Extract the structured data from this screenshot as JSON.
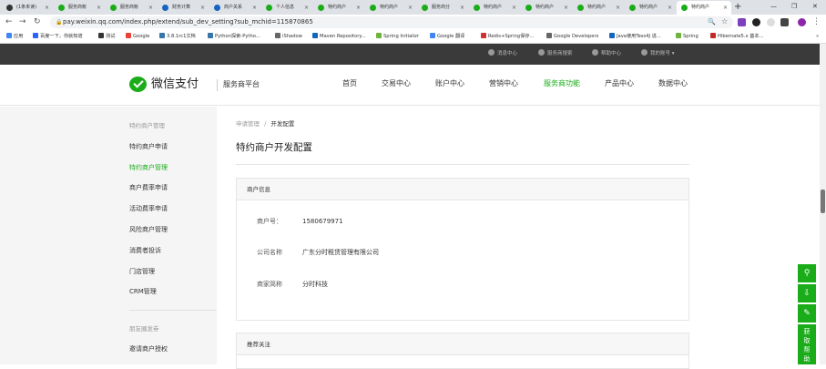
{
  "browser": {
    "tabs": [
      {
        "label": "(1条未读)",
        "color": "#333333"
      },
      {
        "label": "服务商帐",
        "color": "#1aad19"
      },
      {
        "label": "服务商帐",
        "color": "#1aad19"
      },
      {
        "label": "财务计算",
        "color": "#1565c0"
      },
      {
        "label": "商户关系",
        "color": "#1565c0"
      },
      {
        "label": "个人信息",
        "color": "#1aad19"
      },
      {
        "label": "特约商户",
        "color": "#1aad19"
      },
      {
        "label": "特约商户",
        "color": "#1aad19"
      },
      {
        "label": "服务商分",
        "color": "#1aad19"
      },
      {
        "label": "特约商户",
        "color": "#1aad19"
      },
      {
        "label": "特约商户",
        "color": "#1aad19"
      },
      {
        "label": "特约商户",
        "color": "#1aad19"
      },
      {
        "label": "特约商户",
        "color": "#1aad19"
      },
      {
        "label": "特约商户",
        "color": "#1aad19"
      }
    ],
    "url": "pay.weixin.qq.com/index.php/extend/sub_dev_setting?sub_mchid=115870865",
    "bookmarks": [
      {
        "label": "应用",
        "color": "#4285f4"
      },
      {
        "label": "百度一下，你就知道",
        "color": "#2962ff"
      },
      {
        "label": "测试",
        "color": "#333333"
      },
      {
        "label": "Google",
        "color": "#ea4335"
      },
      {
        "label": "3.8.1rc1文档",
        "color": "#3776ab"
      },
      {
        "label": "Python探索-Pytho...",
        "color": "#3776ab"
      },
      {
        "label": "iShadow",
        "color": "#666666"
      },
      {
        "label": "Maven Repository...",
        "color": "#1565c0"
      },
      {
        "label": "Spring Initializr",
        "color": "#6db33f"
      },
      {
        "label": "Google 翻译",
        "color": "#4285f4"
      },
      {
        "label": "Redis+Spring保存...",
        "color": "#d32f2f"
      },
      {
        "label": "Google Developers",
        "color": "#666666"
      },
      {
        "label": "Java使用Tess4J 进...",
        "color": "#1565c0"
      },
      {
        "label": "Spring",
        "color": "#6db33f"
      },
      {
        "label": "Hibernate5.x 基本...",
        "color": "#c62828"
      }
    ]
  },
  "topbar": {
    "items": [
      "消息中心",
      "服务商搜索",
      "帮助中心",
      "我的账号"
    ]
  },
  "header": {
    "logo_text": "微信支付",
    "logo_sub": "服务商平台",
    "nav": [
      "首页",
      "交易中心",
      "账户中心",
      "营销中心",
      "服务商功能",
      "产品中心",
      "数据中心"
    ],
    "active_nav": "服务商功能"
  },
  "sidebar": {
    "group1": "特约商户管理",
    "items1": [
      "特约商户申请",
      "特约商户管理",
      "商户费率申请",
      "活动费率申请",
      "风险商户管理",
      "消费者投诉",
      "门店管理",
      "CRM管理"
    ],
    "active_item": "特约商户管理",
    "group2": "朋友圈发券",
    "items2": [
      "邀请商户授权"
    ]
  },
  "main": {
    "breadcrumb_parent": "申请管理",
    "breadcrumb_sep": "/",
    "breadcrumb_current": "开发配置",
    "title": "特约商户开发配置",
    "merchant_panel": {
      "title": "商户信息",
      "fields": [
        {
          "label": "商户号：",
          "value": "1580679971"
        },
        {
          "label": "公司名称",
          "value": "广东分时租赁管理有限公司"
        },
        {
          "label": "商家简称",
          "value": "分时科技"
        }
      ]
    },
    "recommend_panel": {
      "title": "推荐关注"
    }
  },
  "float": {
    "buttons": [
      "link-icon",
      "download-icon",
      "edit-icon"
    ],
    "help": "获取帮助"
  },
  "colors": {
    "accent": "#1aad19",
    "topbar": "#3a3a3a"
  }
}
